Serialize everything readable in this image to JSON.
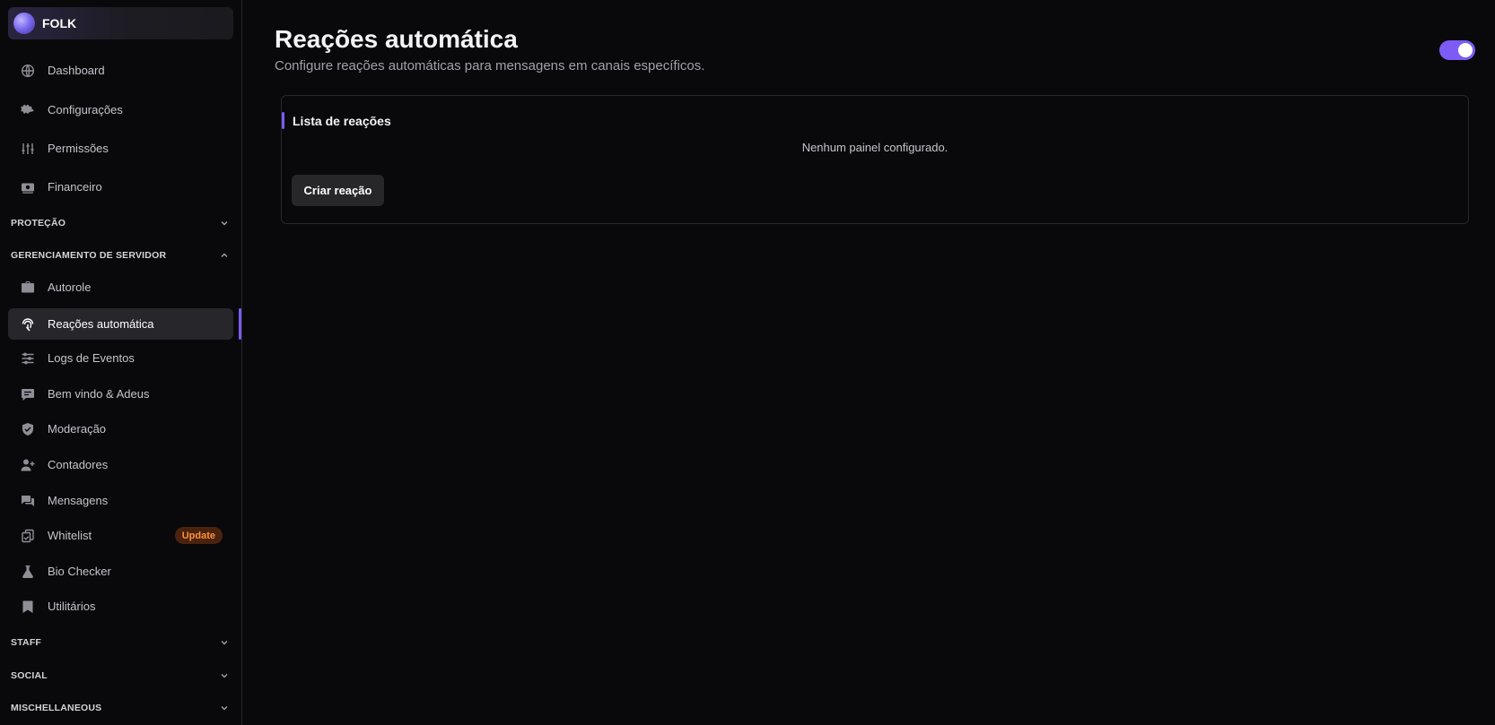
{
  "server": {
    "name": "FOLK"
  },
  "sidebar": {
    "top_items": [
      {
        "label": "Dashboard",
        "icon": "globe-icon"
      },
      {
        "label": "Configurações",
        "icon": "gear-icon"
      },
      {
        "label": "Permissões",
        "icon": "sliders-icon"
      },
      {
        "label": "Financeiro",
        "icon": "money-icon"
      }
    ],
    "sections": {
      "protecao": "PROTEÇÃO",
      "gerenciamento": "GERENCIAMENTO DE SERVIDOR",
      "staff": "STAFF",
      "social": "SOCIAL",
      "misc": "MISCHELLANEOUS"
    },
    "server_items": [
      {
        "label": "Autorole",
        "icon": "briefcase-icon"
      },
      {
        "label": "Reações automática",
        "icon": "fingerprint-icon"
      },
      {
        "label": "Logs de Eventos",
        "icon": "logs-icon"
      },
      {
        "label": "Bem vindo & Adeus",
        "icon": "chat-icon"
      },
      {
        "label": "Moderação",
        "icon": "shield-check-icon"
      },
      {
        "label": "Contadores",
        "icon": "user-plus-icon"
      },
      {
        "label": "Mensagens",
        "icon": "messages-icon"
      },
      {
        "label": "Whitelist",
        "icon": "copy-check-icon",
        "badge": "Update"
      },
      {
        "label": "Bio Checker",
        "icon": "flask-icon"
      },
      {
        "label": "Utilitários",
        "icon": "bookmark-icon"
      }
    ]
  },
  "page": {
    "title": "Reações automática",
    "subtitle": "Configure reações automáticas para mensagens em canais específicos.",
    "enabled": true
  },
  "card": {
    "title": "Lista de reações",
    "empty_text": "Nenhum painel configurado.",
    "create_label": "Criar reação"
  },
  "colors": {
    "accent": "#7c5cf5",
    "badge_bg": "#4a230f",
    "badge_text": "#fb923c",
    "background": "#09090b"
  }
}
